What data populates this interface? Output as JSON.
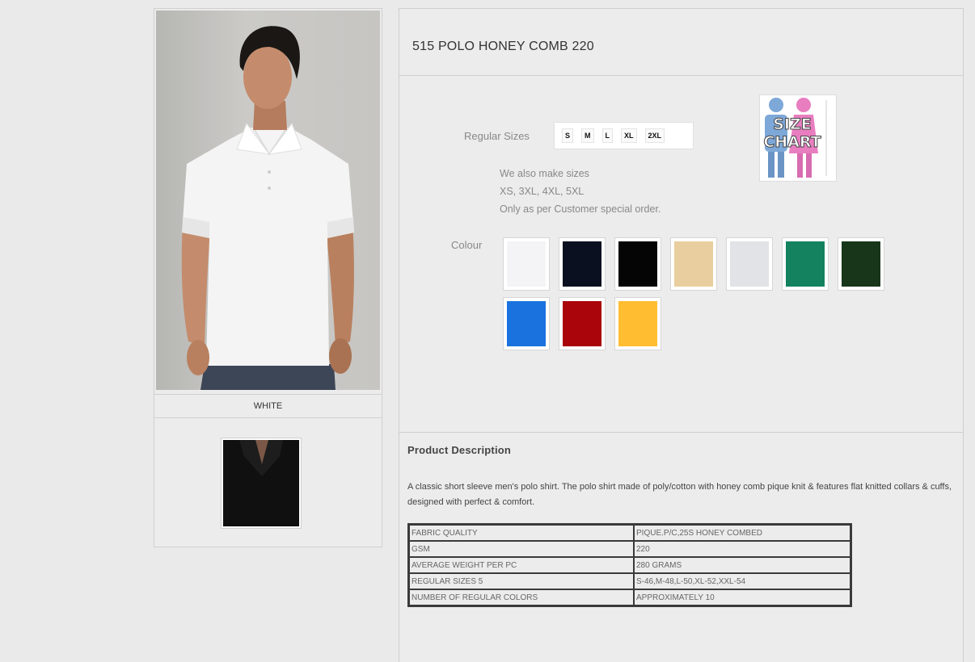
{
  "product": {
    "title": "515 POLO HONEY COMB 220",
    "main_image_caption": "WHITE"
  },
  "sizes": {
    "label": "Regular Sizes",
    "options": [
      "S",
      "M",
      "L",
      "XL",
      "2XL"
    ],
    "extra_note_line1": "We also make sizes",
    "extra_note_line2": "XS, 3XL, 4XL, 5XL",
    "extra_note_line3": "Only as per Customer special order.",
    "size_chart_label_line1": "SIZE",
    "size_chart_label_line2": "CHART"
  },
  "colours": {
    "label": "Colour",
    "swatches": [
      "#f4f4f6",
      "#0b1020",
      "#050505",
      "#e9cf9f",
      "#e2e3e6",
      "#14815f",
      "#17361a",
      "#1a72df",
      "#aa050a",
      "#ffbd32"
    ]
  },
  "description": {
    "heading": "Product Description",
    "text": "A classic short sleeve men's polo shirt. The polo shirt made of poly/cotton with honey comb pique knit & features flat knitted collars & cuffs, designed with perfect & comfort.",
    "specs": [
      [
        "FABRIC QUALITY",
        "PIQUE.P/C,25s HONEY COMBED"
      ],
      [
        "GSM",
        "220"
      ],
      [
        "AVERAGE WEIGHT PER PC",
        "280 GRAMS"
      ],
      [
        "REGULAR SIZES 5",
        "S-46,M-48,L-50,XL-52,XXL-54"
      ],
      [
        "NUMBER OF REGULAR COLORS",
        "APPROXIMATELY 10"
      ]
    ]
  }
}
